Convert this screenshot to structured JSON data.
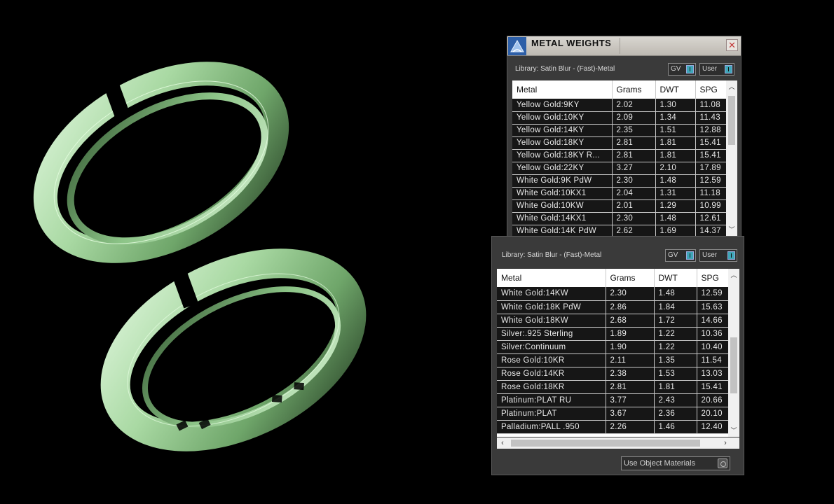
{
  "window": {
    "title": "METAL WEIGHTS",
    "close_label": "✕",
    "accent": "#3fa6b8"
  },
  "panel1": {
    "library_label": "Library: Satin Blur - (Fast)-Metal",
    "gv_label": "GV",
    "user_label": "User",
    "columns": [
      "Metal",
      "Grams",
      "DWT",
      "SPG"
    ],
    "rows": [
      [
        "Yellow Gold:9KY",
        "2.02",
        "1.30",
        "11.08"
      ],
      [
        "Yellow Gold:10KY",
        "2.09",
        "1.34",
        "11.43"
      ],
      [
        "Yellow Gold:14KY",
        "2.35",
        "1.51",
        "12.88"
      ],
      [
        "Yellow Gold:18KY",
        "2.81",
        "1.81",
        "15.41"
      ],
      [
        "Yellow Gold:18KY R...",
        "2.81",
        "1.81",
        "15.41"
      ],
      [
        "Yellow Gold:22KY",
        "3.27",
        "2.10",
        "17.89"
      ],
      [
        "White Gold:9K PdW",
        "2.30",
        "1.48",
        "12.59"
      ],
      [
        "White Gold:10KX1",
        "2.04",
        "1.31",
        "11.18"
      ],
      [
        "White Gold:10KW",
        "2.01",
        "1.29",
        "10.99"
      ],
      [
        "White Gold:14KX1",
        "2.30",
        "1.48",
        "12.61"
      ],
      [
        "White Gold:14K PdW",
        "2.62",
        "1.69",
        "14.37"
      ]
    ]
  },
  "panel2": {
    "library_label": "Library: Satin Blur - (Fast)-Metal",
    "gv_label": "GV",
    "user_label": "User",
    "columns": [
      "Metal",
      "Grams",
      "DWT",
      "SPG"
    ],
    "rows": [
      [
        "White Gold:14KW",
        "2.30",
        "1.48",
        "12.59"
      ],
      [
        "White Gold:18K PdW",
        "2.86",
        "1.84",
        "15.63"
      ],
      [
        "White Gold:18KW",
        "2.68",
        "1.72",
        "14.66"
      ],
      [
        "Silver:.925 Sterling",
        "1.89",
        "1.22",
        "10.36"
      ],
      [
        "Silver:Continuum",
        "1.90",
        "1.22",
        "10.40"
      ],
      [
        "Rose Gold:10KR",
        "2.11",
        "1.35",
        "11.54"
      ],
      [
        "Rose Gold:14KR",
        "2.38",
        "1.53",
        "13.03"
      ],
      [
        "Rose Gold:18KR",
        "2.81",
        "1.81",
        "15.41"
      ],
      [
        "Platinum:PLAT RU",
        "3.77",
        "2.43",
        "20.66"
      ],
      [
        "Platinum:PLAT",
        "3.67",
        "2.36",
        "20.10"
      ],
      [
        "Palladium:PALL .950",
        "2.26",
        "1.46",
        "12.40"
      ]
    ],
    "use_object_materials_label": "Use Object Materials"
  }
}
